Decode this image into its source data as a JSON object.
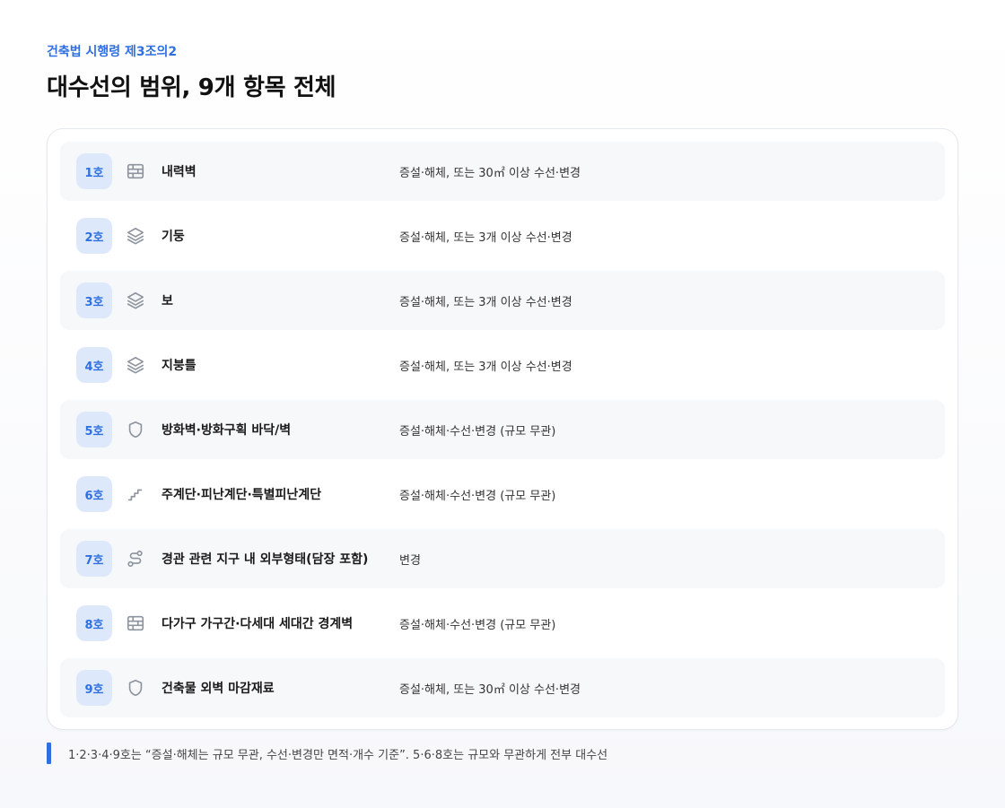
{
  "header": {
    "eyebrow": "건축법 시행령 제3조의2",
    "title": "대수선의 범위, 9개 항목 전체"
  },
  "items": [
    {
      "no": "1호",
      "icon": "wall-icon",
      "name": "내력벽",
      "desc": "증설·해체, 또는 30㎡ 이상 수선·변경"
    },
    {
      "no": "2호",
      "icon": "layers-icon",
      "name": "기둥",
      "desc": "증설·해체, 또는 3개 이상 수선·변경"
    },
    {
      "no": "3호",
      "icon": "layers-icon",
      "name": "보",
      "desc": "증설·해체, 또는 3개 이상 수선·변경"
    },
    {
      "no": "4호",
      "icon": "layers-icon",
      "name": "지붕틀",
      "desc": "증설·해체, 또는 3개 이상 수선·변경"
    },
    {
      "no": "5호",
      "icon": "shield-icon",
      "name": "방화벽·방화구획 바닥/벽",
      "desc": "증설·해체·수선·변경 (규모 무관)"
    },
    {
      "no": "6호",
      "icon": "stairs-icon",
      "name": "주계단·피난계단·특별피난계단",
      "desc": "증설·해체·수선·변경 (규모 무관)"
    },
    {
      "no": "7호",
      "icon": "route-icon",
      "name": "경관 관련 지구 내 외부형태(담장 포함)",
      "desc": "변경"
    },
    {
      "no": "8호",
      "icon": "wall-icon",
      "name": "다가구 가구간·다세대 세대간 경계벽",
      "desc": "증설·해체·수선·변경 (규모 무관)"
    },
    {
      "no": "9호",
      "icon": "shield-icon",
      "name": "건축물 외벽 마감재료",
      "desc": "증설·해체, 또는 30㎡ 이상 수선·변경"
    }
  ],
  "footnote": "1·2·3·4·9호는 “증설·해체는 규모 무관, 수선·변경만 면적·개수 기준”. 5·6·8호는 규모와 무관하게 전부 대수선",
  "colors": {
    "accent": "#2f6fe0",
    "badge_bg": "#dde9fb",
    "icon": "#8d949e"
  }
}
